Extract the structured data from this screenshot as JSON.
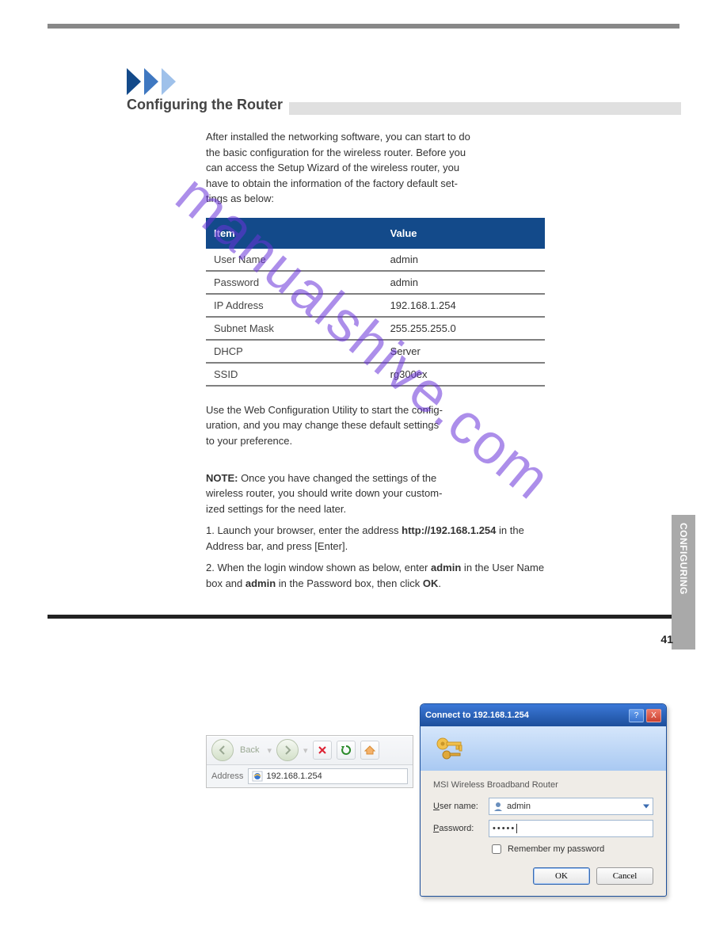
{
  "section": {
    "title": "Configuring the Router",
    "intro": "After installed the networking software, you can start to do\nthe basic configuration for the wireless router. Before you\ncan access the Setup Wizard of the wireless router, you\nhave to obtain the information of the factory default set-\ntings as below:"
  },
  "factory": {
    "headers": {
      "item": "Item",
      "value": "Value"
    },
    "rows": [
      {
        "k": "User Name",
        "v": "admin"
      },
      {
        "k": "Password",
        "v": "admin"
      },
      {
        "k": "IP Address",
        "v": "192.168.1.254"
      },
      {
        "k": "Subnet Mask",
        "v": "255.255.255.0"
      },
      {
        "k": "DHCP",
        "v": "Server"
      },
      {
        "k": "SSID",
        "v": "rg300ex"
      }
    ]
  },
  "instructions": {
    "p1": "Use the Web Configuration Utility to start the config-\nuration, and you may change these default settings\nto your preference.",
    "noteLabel": "NOTE:",
    "noteText": " Once you have changed the settings of the\nwireless router, you should write down your custom-\nized settings for the need later.",
    "step1a": "1. Launch your browser, enter the address ",
    "step1b": "http://192.168.1.254",
    "step1c": " in the Address bar, and press [Enter].",
    "step2a": "2. When the login window shown as below, enter ",
    "step2b": "admin",
    "step2c": " in the User Name box and ",
    "step2d": "admin",
    "step2e": " in the Password box, then click ",
    "step2f": "OK",
    "step2g": "."
  },
  "browser_bar": {
    "back": "Back",
    "address_label": "Address",
    "address_value": "192.168.1.254"
  },
  "dialog": {
    "title": "Connect to 192.168.1.254",
    "server": "MSI Wireless Broadband Router",
    "uname_label_pre": "U",
    "uname_label_rest": "ser name:",
    "uname_value": "admin",
    "pass_label_pre": "P",
    "pass_label_rest": "assword:",
    "pass_value": "•••••",
    "remember_pre": "R",
    "remember_rest": "emember my password",
    "ok": "OK",
    "cancel": "Cancel",
    "help": "?",
    "close": "X"
  },
  "sidetab": "CONFIGURING",
  "page_number": "41",
  "watermark": "manualshive.com"
}
